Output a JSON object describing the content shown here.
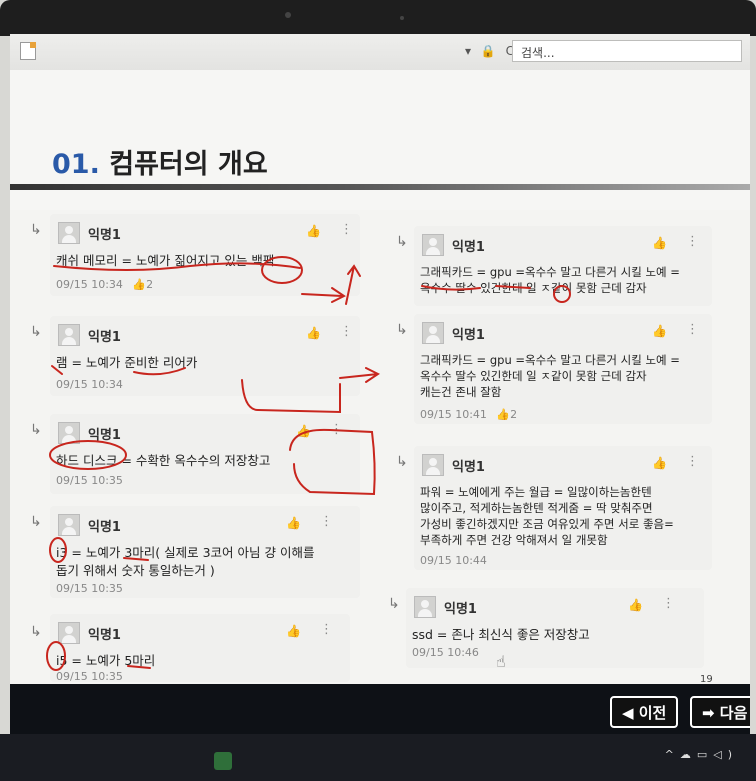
{
  "browser": {
    "search_placeholder": "검색...",
    "address_icons": "▾ 🔒 C"
  },
  "slide": {
    "number": "01.",
    "title": "컴퓨터의 개요",
    "page_number": "19"
  },
  "comments_left": [
    {
      "author": "익명1",
      "body": "캐쉬 메모리 = 노예가 짊어지고 있는 백팩",
      "time": "09/15 10:34",
      "likes": "2"
    },
    {
      "author": "익명1",
      "body": "램 = 노예가 준비한 리어카",
      "time": "09/15 10:34",
      "likes": ""
    },
    {
      "author": "익명1",
      "body": "하드 디스크 = 수확한 옥수수의 저장창고",
      "time": "09/15 10:35",
      "likes": ""
    },
    {
      "author": "익명1",
      "body": "i3 = 노예가 3마리( 실제로 3코어 아님 걍 이해를\n돕기 위해서 숫자 통일하는거 )",
      "time": "09/15 10:35",
      "likes": ""
    },
    {
      "author": "익명1",
      "body": "i5 = 노예가 5마리",
      "time": "09/15 10:35",
      "likes": ""
    }
  ],
  "comments_right": [
    {
      "author": "익명1",
      "body": "그래픽카드 = gpu =옥수수 말고 다른거 시킬 노예 =\n옥수수 딸수 있긴한데 일 ㅈ같이 못함 근데 감자",
      "time": "",
      "likes": ""
    },
    {
      "author": "익명1",
      "body": "그래픽카드 = gpu =옥수수 말고 다른거 시킬 노예 =\n옥수수 딸수 있긴한데 일 ㅈ같이 못함 근데 감자\n캐는건 존내 잘함",
      "time": "09/15 10:41",
      "likes": "2"
    },
    {
      "author": "익명1",
      "body": "파워 = 노예에게 주는 월급 = 일많이하는놈한텐\n많이주고, 적게하는놈한텐 적게줌 = 딱 맞춰주면\n가성비 좋긴하겠지만 조금 여유있게 주면 서로 좋음=\n부족하게 주면 건강 악해져서 일 개못함",
      "time": "09/15 10:44",
      "likes": ""
    },
    {
      "author": "익명1",
      "body": "ssd = 존나 최신식 좋은 저장창고",
      "time": "09/15 10:46",
      "likes": ""
    }
  ],
  "navigation": {
    "prev_label": "◀ 이전",
    "next_label": "➡ 다음"
  },
  "icons": {
    "like": "thumbs-up-icon",
    "more": "more-vertical-icon",
    "reply": "reply-arrow-icon"
  },
  "colors": {
    "title_number": "#2a5aa8",
    "annotation_pen": "#c8261e",
    "nav_background": "#0e1116"
  }
}
